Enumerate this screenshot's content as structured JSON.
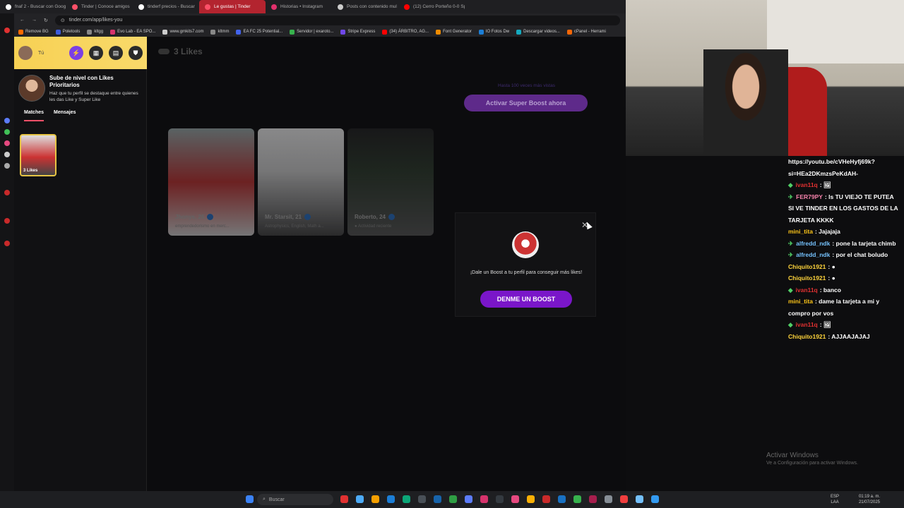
{
  "browser": {
    "tabs": [
      {
        "label": "fnaf 2 - Buscar con Goog",
        "color": "#ffffff",
        "active": false
      },
      {
        "label": "Tinder | Conoce amigos",
        "color": "#fd5068",
        "active": false
      },
      {
        "label": "tinderf precios - Buscar",
        "color": "#ffffff",
        "active": false
      },
      {
        "label": "Le gustas | Tinder",
        "color": "#fd5068",
        "active": true
      },
      {
        "label": "Historias • Instagram",
        "color": "#e1306c",
        "active": false
      },
      {
        "label": "Posts con contenido mul",
        "color": "#cccccc",
        "active": false
      },
      {
        "label": "(12) Cerro Porteño 0-0 Sp",
        "color": "#ff0000",
        "active": false
      }
    ],
    "url": "tinder.com/app/likes-you",
    "bookmarks": [
      {
        "label": "Remove BG",
        "color": "#ff6a00"
      },
      {
        "label": "Poletools",
        "color": "#3b5bdb"
      },
      {
        "label": "kltgg",
        "color": "#888888"
      },
      {
        "label": "Evo Lab - EA SPO...",
        "color": "#d6336c"
      },
      {
        "label": "www.gmkits7.com",
        "color": "#cccccc"
      },
      {
        "label": "kltmm",
        "color": "#888888"
      },
      {
        "label": "EA FC 25 Potential...",
        "color": "#4263eb"
      },
      {
        "label": "Servidor | exaroto...",
        "color": "#37b24d"
      },
      {
        "label": "Stripe Express",
        "color": "#7048e8"
      },
      {
        "label": "(34) ÁRBITRO, AG...",
        "color": "#ff0000"
      },
      {
        "label": "Font Generator",
        "color": "#f08c00"
      },
      {
        "label": "IO Fotos Dw",
        "color": "#1c7ed6"
      },
      {
        "label": "Descargar videos...",
        "color": "#15aabf"
      },
      {
        "label": "cPanel - Herrami",
        "color": "#f76707"
      }
    ]
  },
  "sidebar": {
    "user_label": "Tú",
    "promo_title": "Sube de nivel con Likes Prioritarios",
    "promo_sub": "Haz que tu perfil se destaque entre quienes les das Like y Super Like",
    "tabs": [
      "Matches",
      "Mensajes"
    ],
    "match_card_label": "3 Likes"
  },
  "main": {
    "title": "3 Likes",
    "boost_hint": "Hasta 100 veces más vistas",
    "superboost_label": "Activar Super Boost ahora",
    "cards": [
      {
        "name": "Jhonys, 26",
        "sub": "emprendedorismo en merc...",
        "bg": "linear-gradient(180deg,#9aa 0,#b33 50%,#ccc 100%)"
      },
      {
        "name": "Mr. Starsit, 21",
        "sub": "Astrophysics, English, Math a...",
        "bg": "linear-gradient(180deg,#eee 0,#ccc 40%,#444 100%)"
      },
      {
        "name": "Roberto, 24",
        "sub": "● Actividad reciente",
        "bg": "linear-gradient(180deg,#222 0,#2d3b2d 40%,#555 100%)"
      }
    ]
  },
  "modal": {
    "text": "¡Dale un Boost a tu perfil para conseguir más likes!",
    "button": "DENME UN BOOST"
  },
  "chat": [
    {
      "user": "",
      "text": "https://youtu.be/cVHeHyfj69k?si=HEa2DKmzsPeKdAH-",
      "color": "#ffffff",
      "icon": ""
    },
    {
      "user": "ivan11q",
      "text": ": 🖼",
      "color": "#e03131",
      "icon": "◆"
    },
    {
      "user": "FER79PY",
      "text": ": ls TU VIEJO TE PUTEA SI VE TINDER EN LOS GASTOS DE LA TARJETA KKKK",
      "color": "#f783ac",
      "icon": "✈"
    },
    {
      "user": "mini_tita",
      "text": ": Jajajaja",
      "color": "#fcc419",
      "icon": ""
    },
    {
      "user": "alfredd_ndk",
      "text": ": pone la tarjeta chimb",
      "color": "#74c0fc",
      "icon": "✈"
    },
    {
      "user": "alfredd_ndk",
      "text": ": por el chat boludo",
      "color": "#74c0fc",
      "icon": "✈"
    },
    {
      "user": "Chiquito1921",
      "text": ": ●",
      "color": "#ffd43b",
      "icon": ""
    },
    {
      "user": "Chiquito1921",
      "text": ": ●",
      "color": "#ffd43b",
      "icon": ""
    },
    {
      "user": "ivan11q",
      "text": ": banco",
      "color": "#e03131",
      "icon": "◆"
    },
    {
      "user": "mini_tita",
      "text": ": dame la tarjeta a mi y compro por vos",
      "color": "#fcc419",
      "icon": ""
    },
    {
      "user": "ivan11q",
      "text": ": 🖼",
      "color": "#e03131",
      "icon": "◆"
    },
    {
      "user": "Chiquito1921",
      "text": ": AJJAAJAJAJ",
      "color": "#ffd43b",
      "icon": ""
    }
  ],
  "watermark": {
    "title": "Activar Windows",
    "sub": "Ve a Configuración para activar Windows."
  },
  "taskbar": {
    "search_placeholder": "Buscar",
    "lang_1": "ESP",
    "lang_2": "LAA",
    "time": "01:19 a. m.",
    "date": "21/07/2025"
  }
}
